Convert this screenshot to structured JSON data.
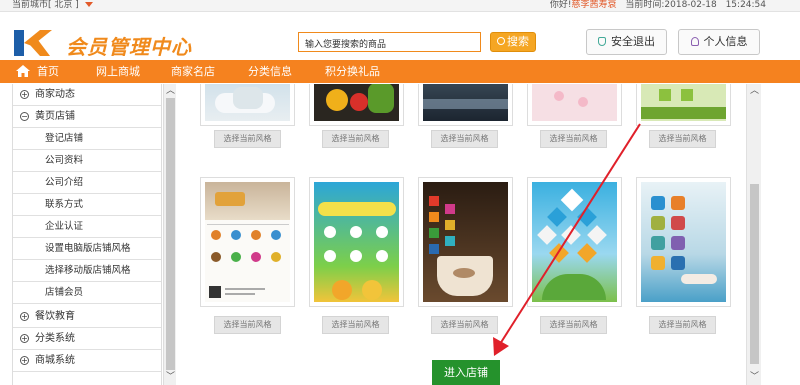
{
  "topbar": {
    "city_label": "当前城市[ 北京 ]",
    "greeting": "你好!",
    "username": "慈李茜寿衰",
    "time_label": "当前时间:",
    "date": "2018-02-18",
    "time": "15:24:54"
  },
  "header": {
    "logo_text": "会员管理中心",
    "search_value": "输入您要搜索的商品",
    "search_button": "搜索",
    "logout_button": "安全退出",
    "userinfo_button": "个人信息"
  },
  "nav": {
    "items": [
      "首页",
      "网上商城",
      "商家名店",
      "分类信息",
      "积分换礼品"
    ]
  },
  "sidebar": {
    "items": [
      {
        "label": "商家动态",
        "icon": "⊕",
        "type": "group"
      },
      {
        "label": "黄页店铺",
        "icon": "⊖",
        "type": "group"
      },
      {
        "label": "登记店铺",
        "type": "sub"
      },
      {
        "label": "公司资料",
        "type": "sub"
      },
      {
        "label": "公司介绍",
        "type": "sub"
      },
      {
        "label": "联系方式",
        "type": "sub"
      },
      {
        "label": "企业认证",
        "type": "sub"
      },
      {
        "label": "设置电脑版店铺风格",
        "type": "sub"
      },
      {
        "label": "选择移动版店铺风格",
        "type": "sub"
      },
      {
        "label": "店铺会员",
        "type": "sub"
      },
      {
        "label": "餐饮教育",
        "icon": "⊕",
        "type": "group"
      },
      {
        "label": "分类系统",
        "icon": "⊕",
        "type": "group"
      },
      {
        "label": "商城系统",
        "icon": "⊕",
        "type": "group"
      }
    ]
  },
  "main": {
    "select_label": "选择当前风格",
    "enter_button": "进入店铺"
  },
  "colors": {
    "accent": "#f5821f",
    "logo": "#f08a1c",
    "enter": "#25922c",
    "arrow": "#e0202a"
  },
  "icons": {
    "home": "home-icon",
    "search": "search-icon",
    "logout": "shield-icon",
    "user": "user-icon"
  }
}
